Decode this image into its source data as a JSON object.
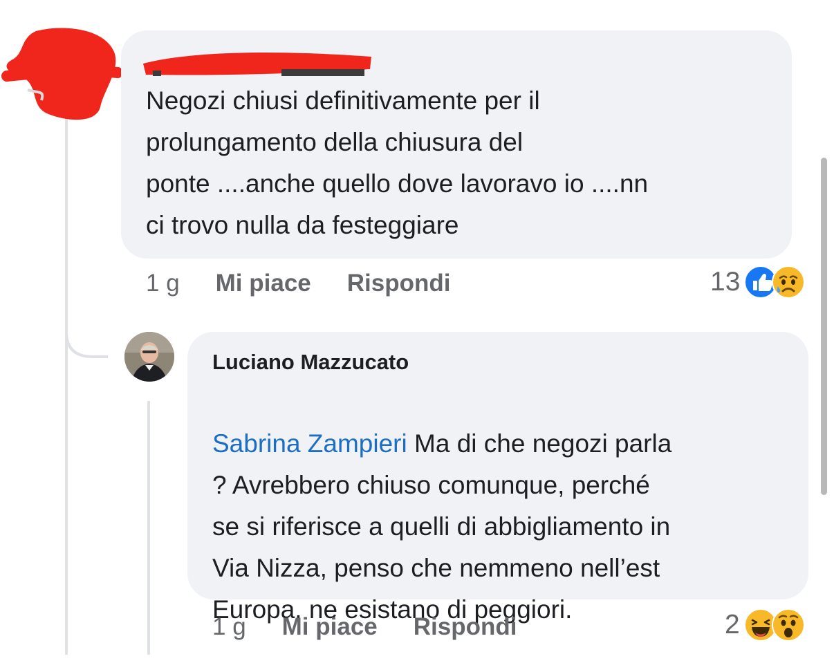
{
  "comment1": {
    "author": "",
    "text": "Negozi chiusi definitivamente per il\nprolungamento della chiusura del\nponte ....anche quello dove lavoravo io ....nn\nci trovo nulla da festeggiare",
    "time": "1 g",
    "like_label": "Mi piace",
    "reply_label": "Rispondi",
    "reaction_count": "13",
    "reactions": [
      "like-icon",
      "sad-icon"
    ]
  },
  "reply1": {
    "author": "Luciano Mazzucato",
    "mention": "Sabrina Zampieri",
    "text_first_line": " Ma di che negozi parla",
    "text_rest": "? Avrebbero chiuso comunque, perché\nse si riferisce a quelli di abbigliamento in\nVia Nizza, penso che nemmeno nell’est\nEuropa, ne esistano di peggiori.",
    "time": "1 g",
    "like_label": "Mi piace",
    "reply_label": "Rispondi",
    "reaction_count": "2",
    "reactions": [
      "haha-icon",
      "wow-icon"
    ]
  },
  "colors": {
    "bubble": "#f0f2f5",
    "mention": "#1b6ec2",
    "like_blue": "#1877f2",
    "emoji_yellow": "#f7b928",
    "redaction": "#f0261c"
  }
}
